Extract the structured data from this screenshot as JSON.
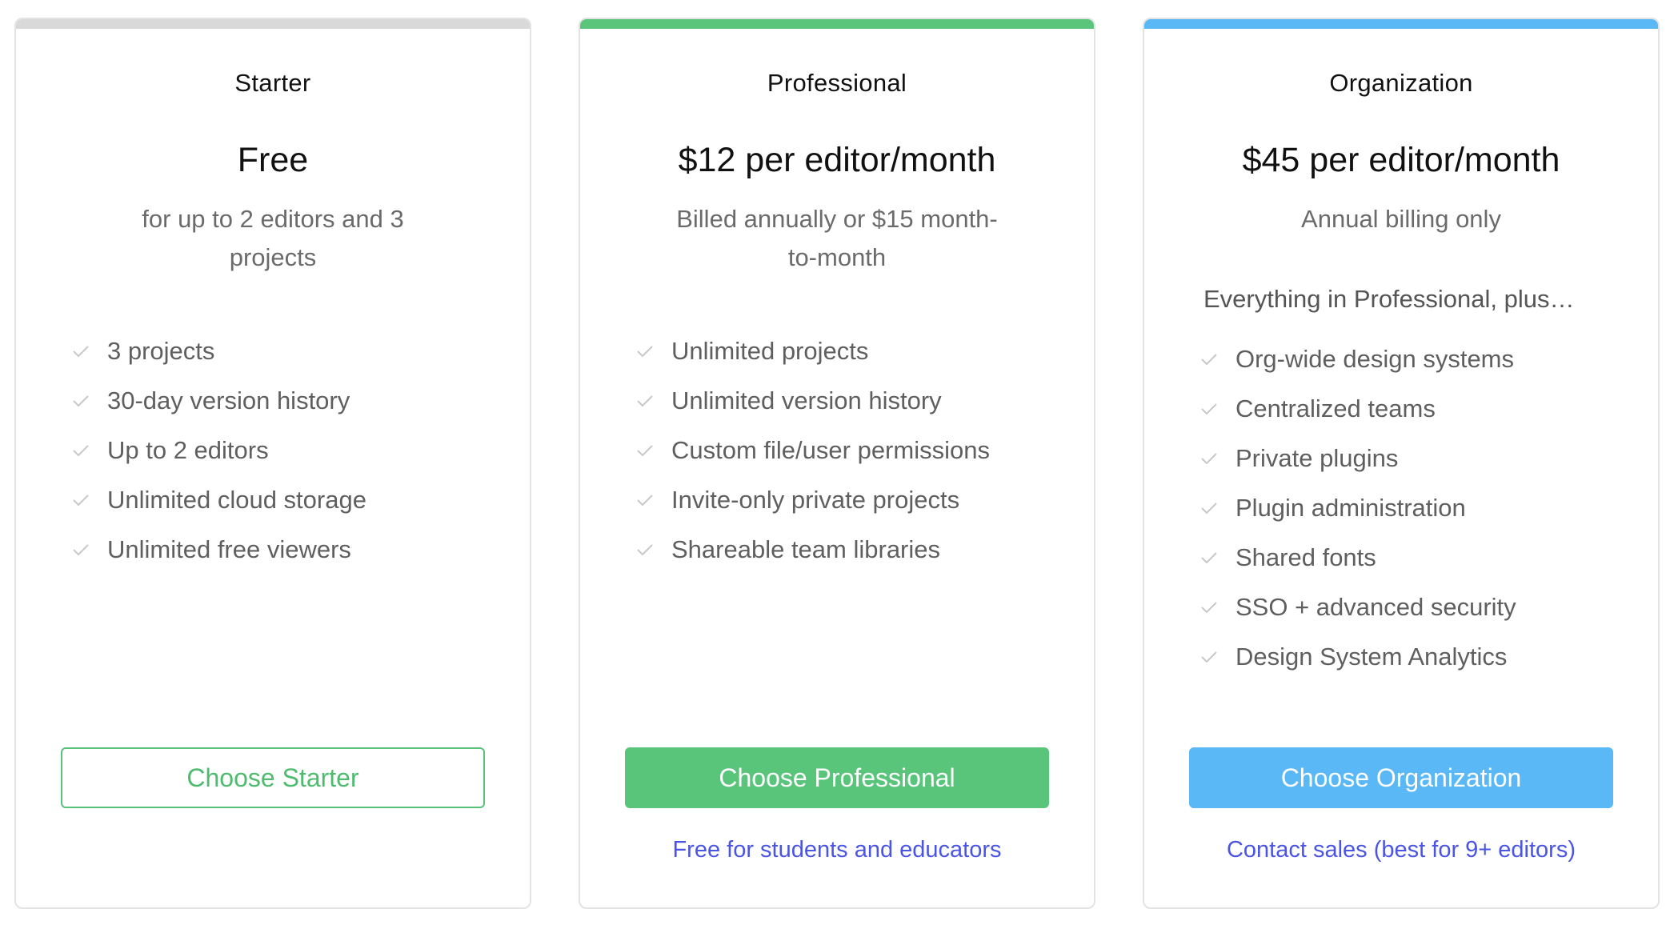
{
  "colors": {
    "starter_bar": "#d9d9d9",
    "professional_bar": "#5bc57b",
    "organization_bar": "#5ab8f7",
    "green_accent": "#59c57b",
    "blue_accent": "#5ab8f7",
    "link": "#4a55e6"
  },
  "plans": [
    {
      "tier": "Starter",
      "price": "Free",
      "subtitle": "for up to 2 editors and 3 projects",
      "intro": "",
      "features": [
        "3 projects",
        "30-day version history",
        "Up to 2 editors",
        "Unlimited cloud storage",
        "Unlimited free viewers"
      ],
      "cta": "Choose Starter",
      "link": ""
    },
    {
      "tier": "Professional",
      "price": "$12 per editor/month",
      "subtitle": "Billed annually or $15 month-to-month",
      "intro": "",
      "features": [
        "Unlimited projects",
        "Unlimited version history",
        "Custom file/user permissions",
        "Invite-only private projects",
        "Shareable team libraries"
      ],
      "cta": "Choose Professional",
      "link": "Free for students and educators"
    },
    {
      "tier": "Organization",
      "price": "$45 per editor/month",
      "subtitle": "Annual billing only",
      "intro": "Everything in Professional, plus…",
      "features": [
        "Org-wide design systems",
        "Centralized teams",
        "Private plugins",
        "Plugin administration",
        "Shared fonts",
        "SSO + advanced security",
        "Design System Analytics"
      ],
      "cta": "Choose Organization",
      "link": "Contact sales (best for 9+ editors)"
    }
  ],
  "icons": {
    "feature_check": "check-icon"
  }
}
